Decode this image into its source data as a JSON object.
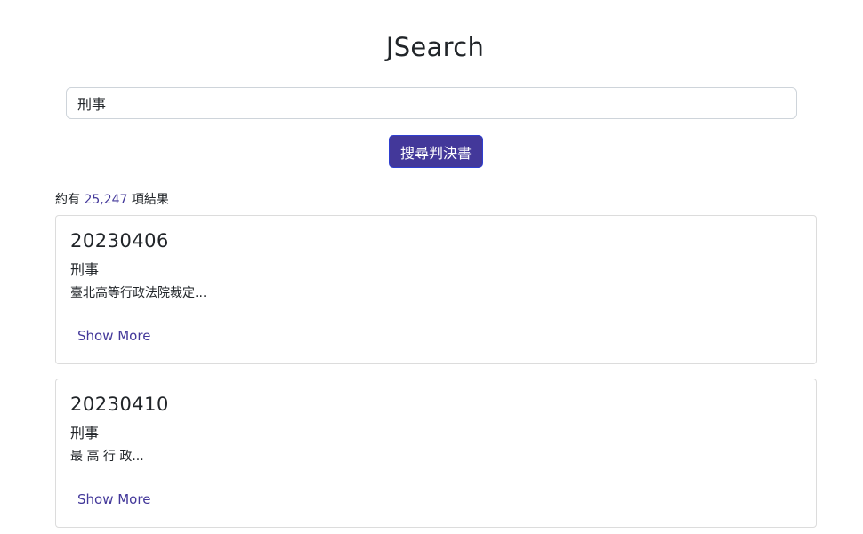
{
  "app": {
    "title": "JSearch"
  },
  "search": {
    "value": "刑事",
    "placeholder": ""
  },
  "search_button": {
    "label": "搜尋判決書"
  },
  "results_summary": {
    "prefix": "約有",
    "count": "25,247",
    "suffix": "項結果"
  },
  "results": [
    {
      "date": "20230406",
      "category": "刑事",
      "snippet": "臺北高等行政法院裁定...",
      "show_more": "Show More"
    },
    {
      "date": "20230410",
      "category": "刑事",
      "snippet": "最 高 行 政...",
      "show_more": "Show More"
    }
  ],
  "colors": {
    "accent": "#43389a",
    "border": "#dcdcdc"
  }
}
